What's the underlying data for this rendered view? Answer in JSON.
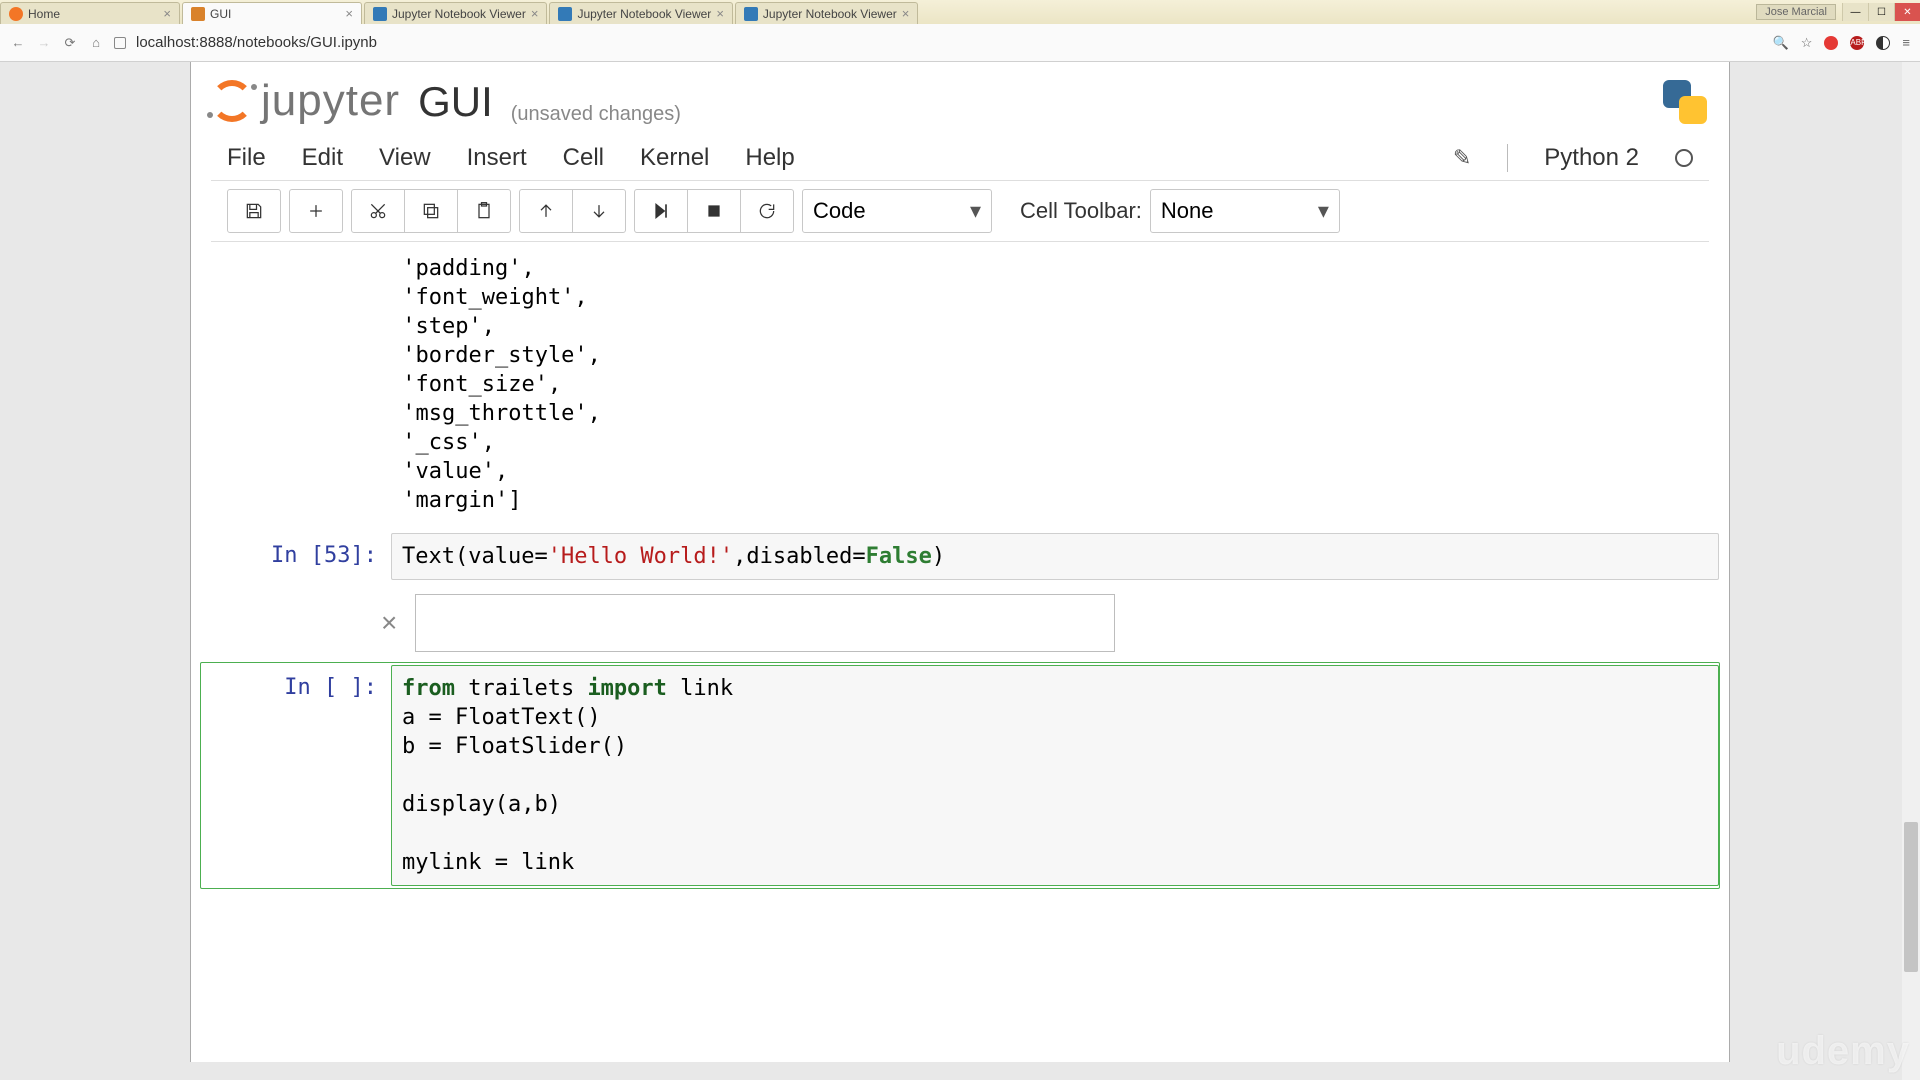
{
  "window": {
    "user_chip": "Jose Marcial",
    "tabs": [
      {
        "label": "Home",
        "active": false
      },
      {
        "label": "GUI",
        "active": true
      },
      {
        "label": "Jupyter Notebook Viewer",
        "active": false
      },
      {
        "label": "Jupyter Notebook Viewer",
        "active": false
      },
      {
        "label": "Jupyter Notebook Viewer",
        "active": false
      }
    ]
  },
  "url": "localhost:8888/notebooks/GUI.ipynb",
  "header": {
    "brand": "jupyter",
    "notebook_name": "GUI",
    "save_status": "(unsaved changes)"
  },
  "menubar": {
    "items": [
      "File",
      "Edit",
      "View",
      "Insert",
      "Cell",
      "Kernel",
      "Help"
    ],
    "kernel_name": "Python 2"
  },
  "toolbar": {
    "cell_type_selected": "Code",
    "cell_toolbar_label": "Cell Toolbar:",
    "cell_toolbar_selected": "None",
    "buttons": {
      "save": "save",
      "add": "add-cell",
      "cut": "cut",
      "copy": "copy",
      "paste": "paste",
      "up": "move-up",
      "down": "move-down",
      "run": "run",
      "stop": "interrupt",
      "restart": "restart"
    }
  },
  "cells": {
    "output0": " 'padding',\n 'font_weight',\n 'step',\n 'border_style',\n 'font_size',\n 'msg_throttle',\n '_css',\n 'value',\n 'margin']",
    "c1": {
      "prompt": "In [53]:",
      "code_pre": "Text(value=",
      "str": "'Hello World!'",
      "code_mid": ",disabled=",
      "kw": "False",
      "code_post": ")"
    },
    "widget_close": "×",
    "c2": {
      "prompt": "In [ ]:",
      "l1a": "from",
      "l1b": " trailets ",
      "l1c": "import",
      "l1d": " link",
      "l2": "a = FloatText()",
      "l3": "b = FloatSlider()",
      "l4": "",
      "l5": "display(a,b)",
      "l6": "",
      "l7": "mylink = link"
    }
  },
  "watermark": "udemy"
}
